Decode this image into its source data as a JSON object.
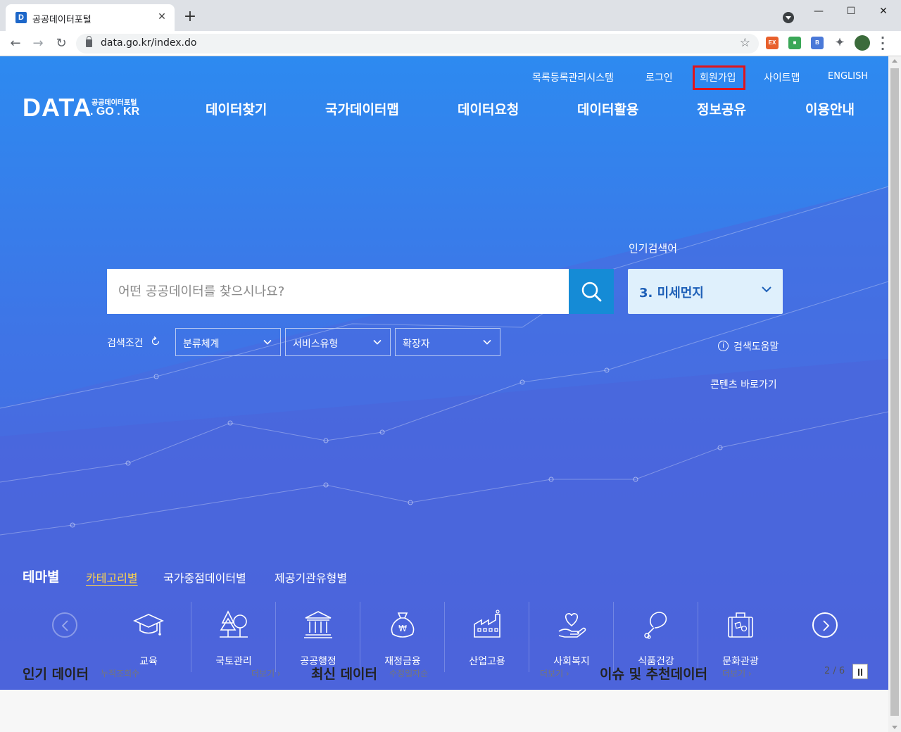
{
  "browser": {
    "tab_title": "공공데이터포털",
    "tab_close": "✕",
    "new_tab": "+",
    "url": "data.go.kr/index.do",
    "window_buttons": {
      "minimize": "—",
      "maximize": "☐",
      "close": "✕"
    },
    "extensions": [
      "EX",
      "■",
      "B"
    ]
  },
  "header": {
    "util_links": [
      "목록등록관리시스템",
      "로그인",
      "회원가입",
      "사이트맵",
      "ENGLISH"
    ],
    "logo": {
      "main": "DATA",
      "sub": "공공데이터포털",
      "domain": ". GO . KR"
    },
    "gnb": [
      "데이터찾기",
      "국가데이터맵",
      "데이터요청",
      "데이터활용",
      "정보공유",
      "이용안내"
    ]
  },
  "search": {
    "placeholder": "어떤 공공데이터를 찾으시나요?",
    "popular_label": "인기검색어",
    "popular_value": "3. 미세먼지",
    "condition_label": "검색조건",
    "filters": [
      "분류체계",
      "서비스유형",
      "확장자"
    ],
    "help_link": "검색도움말",
    "help_icon": "i",
    "shortcut_link": "콘텐츠 바로가기"
  },
  "theme": {
    "title": "테마별",
    "tabs": [
      "카테고리별",
      "국가중점데이터별",
      "제공기관유형별"
    ],
    "categories": [
      {
        "label": "교육",
        "icon": "graduation-cap-icon"
      },
      {
        "label": "국토관리",
        "icon": "trees-icon"
      },
      {
        "label": "공공행정",
        "icon": "government-building-icon"
      },
      {
        "label": "재정금융",
        "icon": "money-bag-icon"
      },
      {
        "label": "산업고용",
        "icon": "factory-icon"
      },
      {
        "label": "사회복지",
        "icon": "heart-hand-icon"
      },
      {
        "label": "식품건강",
        "icon": "chicken-leg-icon"
      },
      {
        "label": "문화관광",
        "icon": "suitcase-icon"
      }
    ]
  },
  "sections": {
    "popular": {
      "title": "인기 데이터",
      "sub": "누적조회수",
      "more": "더보기 ›"
    },
    "latest": {
      "title": "최신 데이터",
      "sub": "수정일자순",
      "more": "더보기 ›"
    },
    "issue": {
      "title": "이슈 및 추천데이터",
      "more": "더보기 ›",
      "pager": "2 / 6"
    }
  },
  "colors": {
    "highlight_box": "#e0141b",
    "active_tab": "#ffd54a",
    "search_button": "#158bd6"
  }
}
